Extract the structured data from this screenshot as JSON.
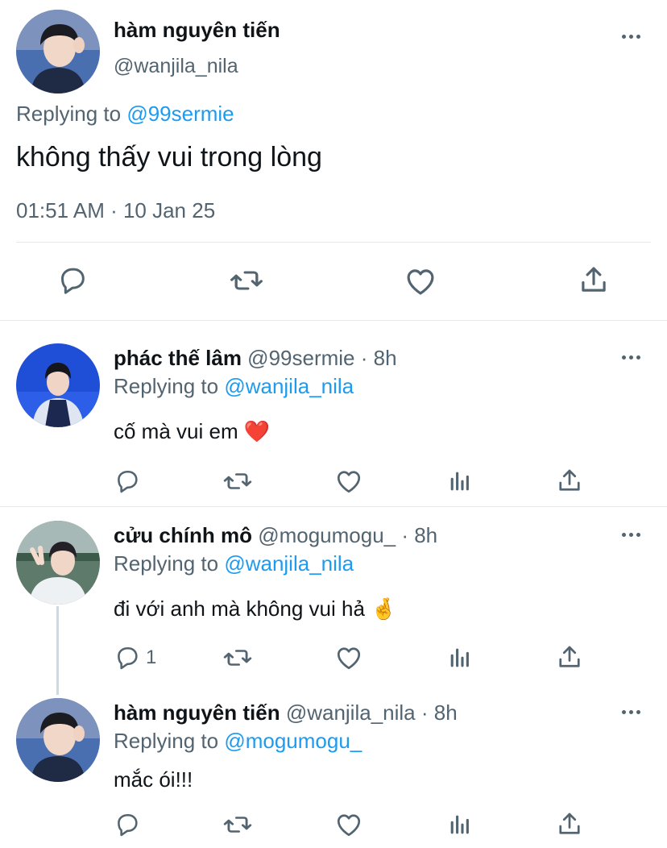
{
  "main_tweet": {
    "display_name": "hàm nguyên tiến",
    "handle": "@wanjila_nila",
    "replying_prefix": "Replying to",
    "replying_to": "@99sermie",
    "text": "không thấy vui trong lòng",
    "timestamp": "01:51 AM · 10 Jan 25"
  },
  "replies": [
    {
      "display_name": "phác thế lâm",
      "handle_time": "@99sermie · 8h",
      "replying_prefix": "Replying to",
      "replying_to": "@wanjila_nila",
      "text": "cố mà vui em ",
      "emoji": "❤️",
      "reply_count": ""
    },
    {
      "display_name": "cửu chính mô",
      "handle_time": "@mogumogu_ · 8h",
      "replying_prefix": "Replying to",
      "replying_to": "@wanjila_nila",
      "text": "đi với anh mà không vui hả ",
      "emoji": "🤞",
      "reply_count": "1"
    },
    {
      "display_name": "hàm nguyên tiến",
      "handle_time": "@wanjila_nila · 8h",
      "replying_prefix": "Replying to",
      "replying_to": "@mogumogu_",
      "text": "mắc ói!!!",
      "reply_count": ""
    }
  ],
  "icons": {
    "reply": "reply-icon",
    "retweet": "retweet-icon",
    "like": "heart-icon",
    "analytics": "analytics-icon",
    "share": "share-icon",
    "more": "more-icon"
  },
  "colors": {
    "link": "#1d9bf0",
    "secondary_text": "#536471",
    "divider": "#e6e9ec"
  }
}
